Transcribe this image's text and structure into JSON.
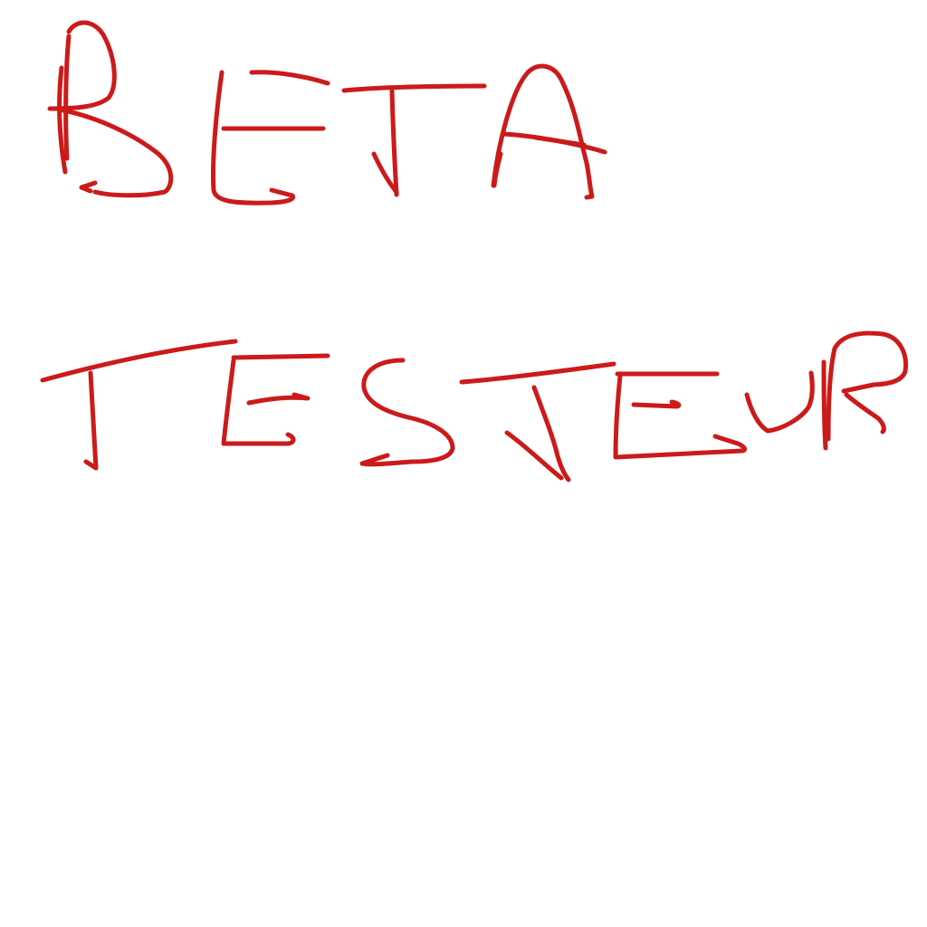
{
  "handwriting": {
    "line1": "BETA",
    "line2": "TESTEUR",
    "ink_color": "#cc1a1a",
    "background_color": "#ffffff"
  }
}
